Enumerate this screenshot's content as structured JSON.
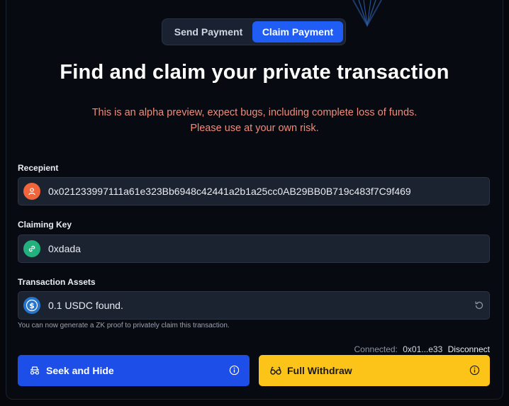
{
  "tabs": {
    "send": "Send Payment",
    "claim": "Claim Payment",
    "active": "claim"
  },
  "page": {
    "title": "Find and claim your private transaction",
    "warning_line1": "This is an alpha preview, expect bugs, including complete loss of funds.",
    "warning_line2": "Please use at your own risk."
  },
  "recipient": {
    "label": "Recepient",
    "value": "0x021233997111a61e323Bb6948c42441a2b1a25cc0AB29BB0B719c483f7C9f469",
    "icon": "user-icon",
    "icon_color": "#f0663a"
  },
  "claiming_key": {
    "label": "Claiming Key",
    "value": "0xdada",
    "icon": "link-icon",
    "icon_color": "#22b07d"
  },
  "assets": {
    "label": "Transaction Assets",
    "value": "0.1 USDC found.",
    "icon": "usdc-icon",
    "icon_color": "#2775ca",
    "hint": "You can now generate a ZK proof to privately claim this transaction."
  },
  "connection": {
    "label": "Connected:",
    "address": "0x01...e33",
    "disconnect": "Disconnect"
  },
  "actions": {
    "seek": "Seek and Hide",
    "full": "Full Withdraw",
    "seek_color": "#1d4fe8",
    "full_color": "#fcc419"
  }
}
